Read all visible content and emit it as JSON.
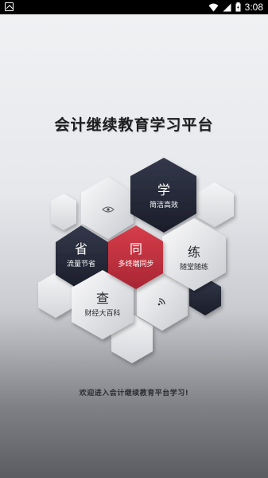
{
  "status_bar": {
    "time": "3:08",
    "icons": [
      "notification-icon",
      "wifi-icon",
      "signal-icon",
      "battery-icon"
    ]
  },
  "app": {
    "title": "会计继续教育学习平台",
    "welcome": "欢迎进入会计继续教育平台学习!"
  },
  "hexes": {
    "xue": {
      "char": "学",
      "sub": "简洁高效"
    },
    "sheng": {
      "char": "省",
      "sub": "流量节省"
    },
    "tong": {
      "char": "同",
      "sub": "多终端同步"
    },
    "lian": {
      "char": "练",
      "sub": "随堂随练"
    },
    "cha": {
      "char": "查",
      "sub": "财经大百科"
    }
  },
  "colors": {
    "dark_navy": "#262a3a",
    "accent_red": "#c8323f",
    "light_hex": "#f3f4f6"
  }
}
